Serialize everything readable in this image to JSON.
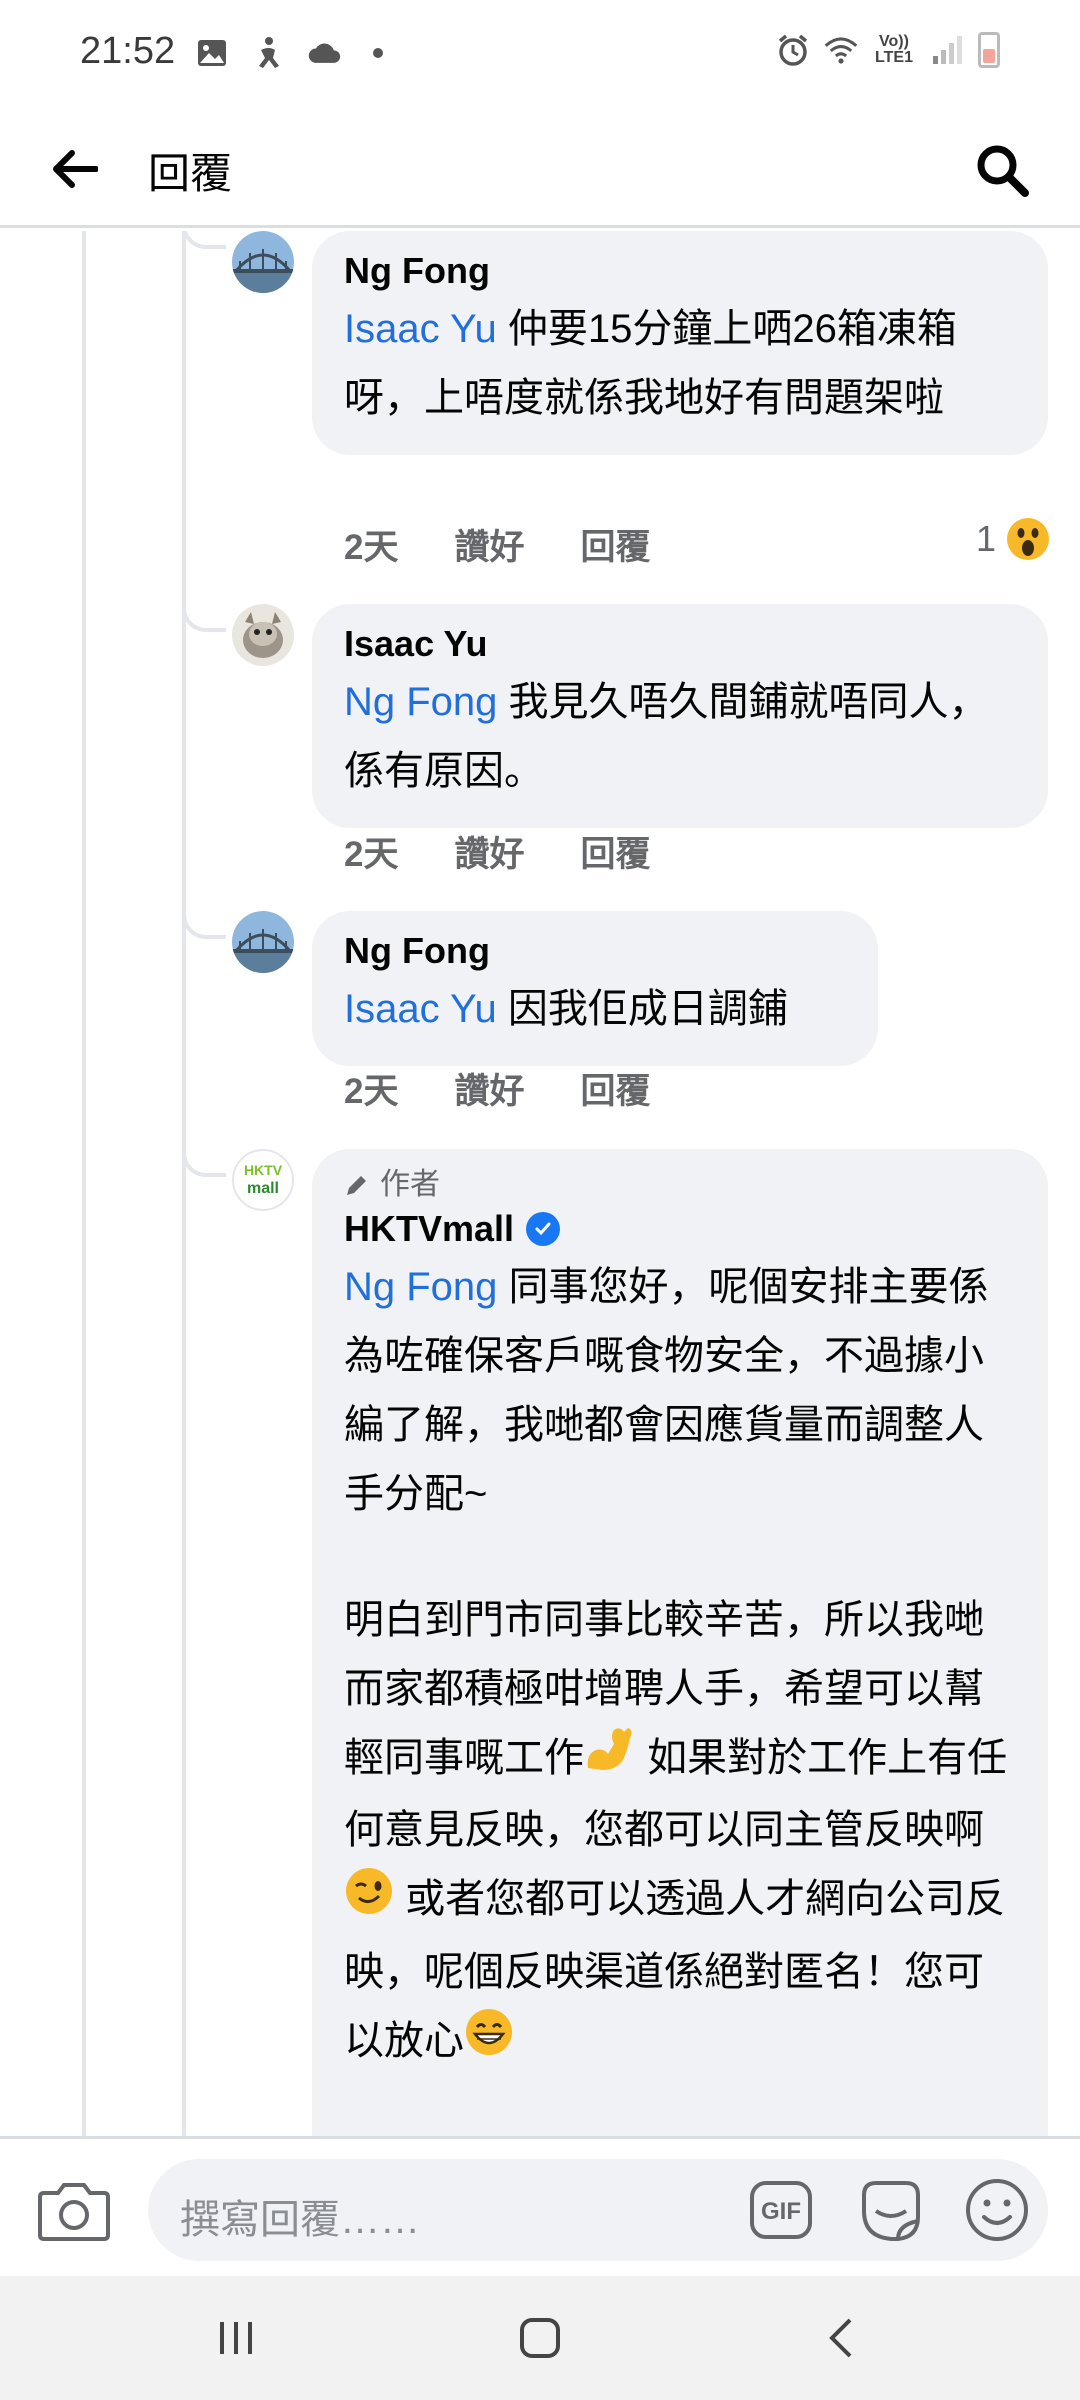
{
  "status_bar": {
    "time": "21:52",
    "network_label": "Vo)) LTE1",
    "battery_color": "#f4a59a"
  },
  "app_bar": {
    "title": "回覆",
    "back_icon": "arrow-left-icon",
    "search_icon": "search-icon"
  },
  "comments": [
    {
      "author": "Ng Fong",
      "mention": "Isaac Yu",
      "text": " 仲要15分鐘上哂26箱凍箱呀，上唔度就係我地好有問題架啦",
      "time": "2天",
      "like_label": "讚好",
      "reply_label": "回覆",
      "reaction_count": "1",
      "reaction": "wow"
    },
    {
      "author": "Isaac Yu",
      "mention": "Ng Fong",
      "text": " 我見久唔久間鋪就唔同人，係有原因。",
      "time": "2天",
      "like_label": "讚好",
      "reply_label": "回覆"
    },
    {
      "author": "Ng Fong",
      "mention": "Isaac Yu",
      "text": " 因我佢成日調鋪",
      "time": "2天",
      "like_label": "讚好",
      "reply_label": "回覆"
    },
    {
      "badge": "作者",
      "author": "HKTVmall",
      "verified": true,
      "mention": "Ng Fong",
      "text_p1": " 同事您好，呢個安排主要係為咗確保客戶嘅食物安全，不過據小編了解，我哋都會因應貨量而調整人手分配~",
      "text_p2a": "明白到門市同事比較辛苦，所以我哋而家都積極咁增聘人手，希望可以幫輕同事嘅工作",
      "text_p2b": " 如果對於工作上有任何意見反映，您都可以同主管反映啊 ",
      "text_p2c": " 或者您都可以透過人才網向公司反映，呢個反映渠道係絕對匿名！您可以放心",
      "avatar_text": "HKTV mall"
    }
  ],
  "composer": {
    "placeholder": "撰寫回覆……",
    "gif_label": "GIF"
  },
  "colors": {
    "mention": "#216fdb",
    "bubble": "#f0f2f5",
    "meta": "#65676b",
    "verified": "#1877f2"
  }
}
